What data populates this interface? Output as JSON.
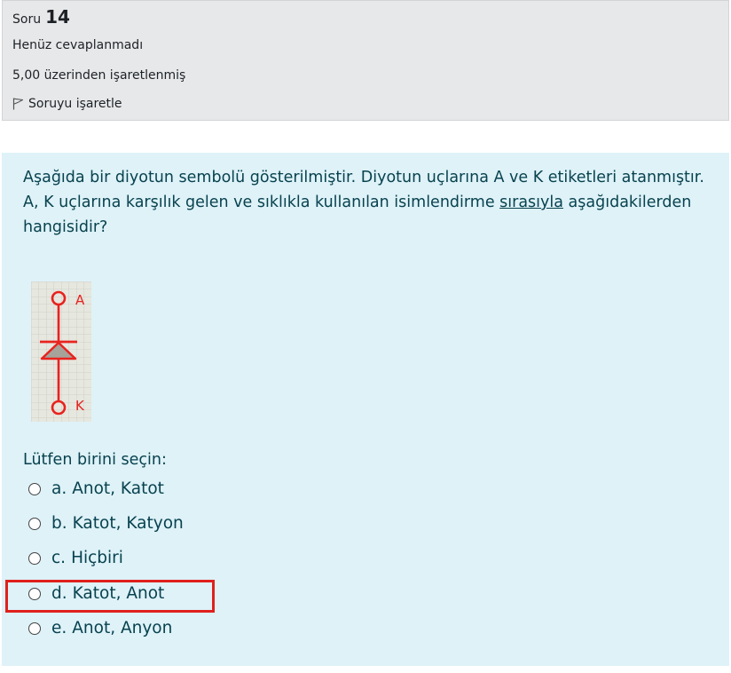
{
  "info": {
    "soru_label": "Soru",
    "soru_number": "14",
    "status": "Henüz cevaplanmadı",
    "mark": "5,00 üzerinden işaretlenmiş",
    "flag_label": "Soruyu işaretle"
  },
  "question": {
    "text_part1": "Aşağıda bir diyotun sembolü gösterilmiştir. Diyotun uçlarına A ve K etiketleri atanmıştır. A, K uçlarına karşılık gelen ve sıklıkla kullanılan isimlendirme ",
    "text_underlined": "sırasıyla",
    "text_part2": " aşağıdakilerden hangisidir?",
    "diagram": {
      "label_top": "A",
      "label_bottom": "K"
    },
    "prompt": "Lütfen birini seçin:",
    "options": [
      {
        "letter": "a.",
        "text": "Anot, Katot"
      },
      {
        "letter": "b.",
        "text": "Katot, Katyon"
      },
      {
        "letter": "c.",
        "text": "Hiçbiri"
      },
      {
        "letter": "d.",
        "text": "Katot, Anot"
      },
      {
        "letter": "e.",
        "text": "Anot, Anyon"
      }
    ],
    "highlighted_option": "d."
  },
  "colors": {
    "info_bg": "#e7e8ea",
    "question_bg": "#def2f8",
    "text": "#08424f",
    "highlight": "#e0201c",
    "diode": "#e8231f"
  }
}
